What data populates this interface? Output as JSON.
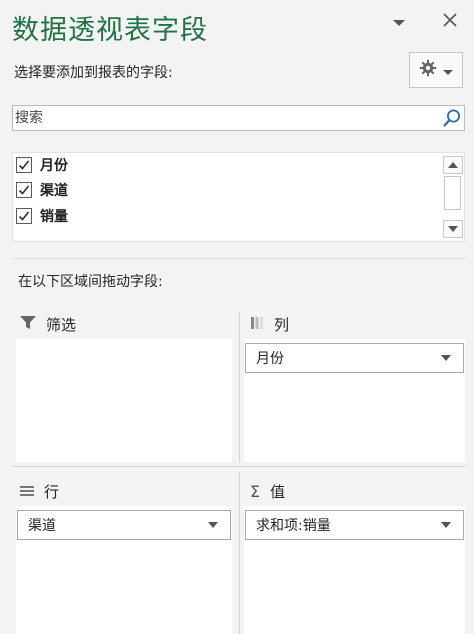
{
  "pane": {
    "title": "数据透视表字段",
    "choose_fields_label": "选择要添加到报表的字段:",
    "search_placeholder": "搜索",
    "icons": {
      "dropdown": "chevron-down-icon",
      "close": "close-icon",
      "tools": "gear-icon",
      "search": "search-icon"
    }
  },
  "fields": [
    {
      "label": "月份",
      "checked": true
    },
    {
      "label": "渠道",
      "checked": true
    },
    {
      "label": "销量",
      "checked": true
    }
  ],
  "areas_label": "在以下区域间拖动字段:",
  "areas": {
    "filters": {
      "title": "筛选",
      "icon": "filter-icon",
      "items": []
    },
    "columns": {
      "title": "列",
      "icon": "columns-icon",
      "items": [
        "月份"
      ]
    },
    "rows": {
      "title": "行",
      "icon": "rows-icon",
      "items": [
        "渠道"
      ]
    },
    "values": {
      "title": "值",
      "icon": "sigma-icon",
      "items": [
        "求和项:销量"
      ]
    }
  },
  "colors": {
    "title": "#217346",
    "background": "#f3f3f3",
    "accent_icon": "#2b6cb0"
  }
}
